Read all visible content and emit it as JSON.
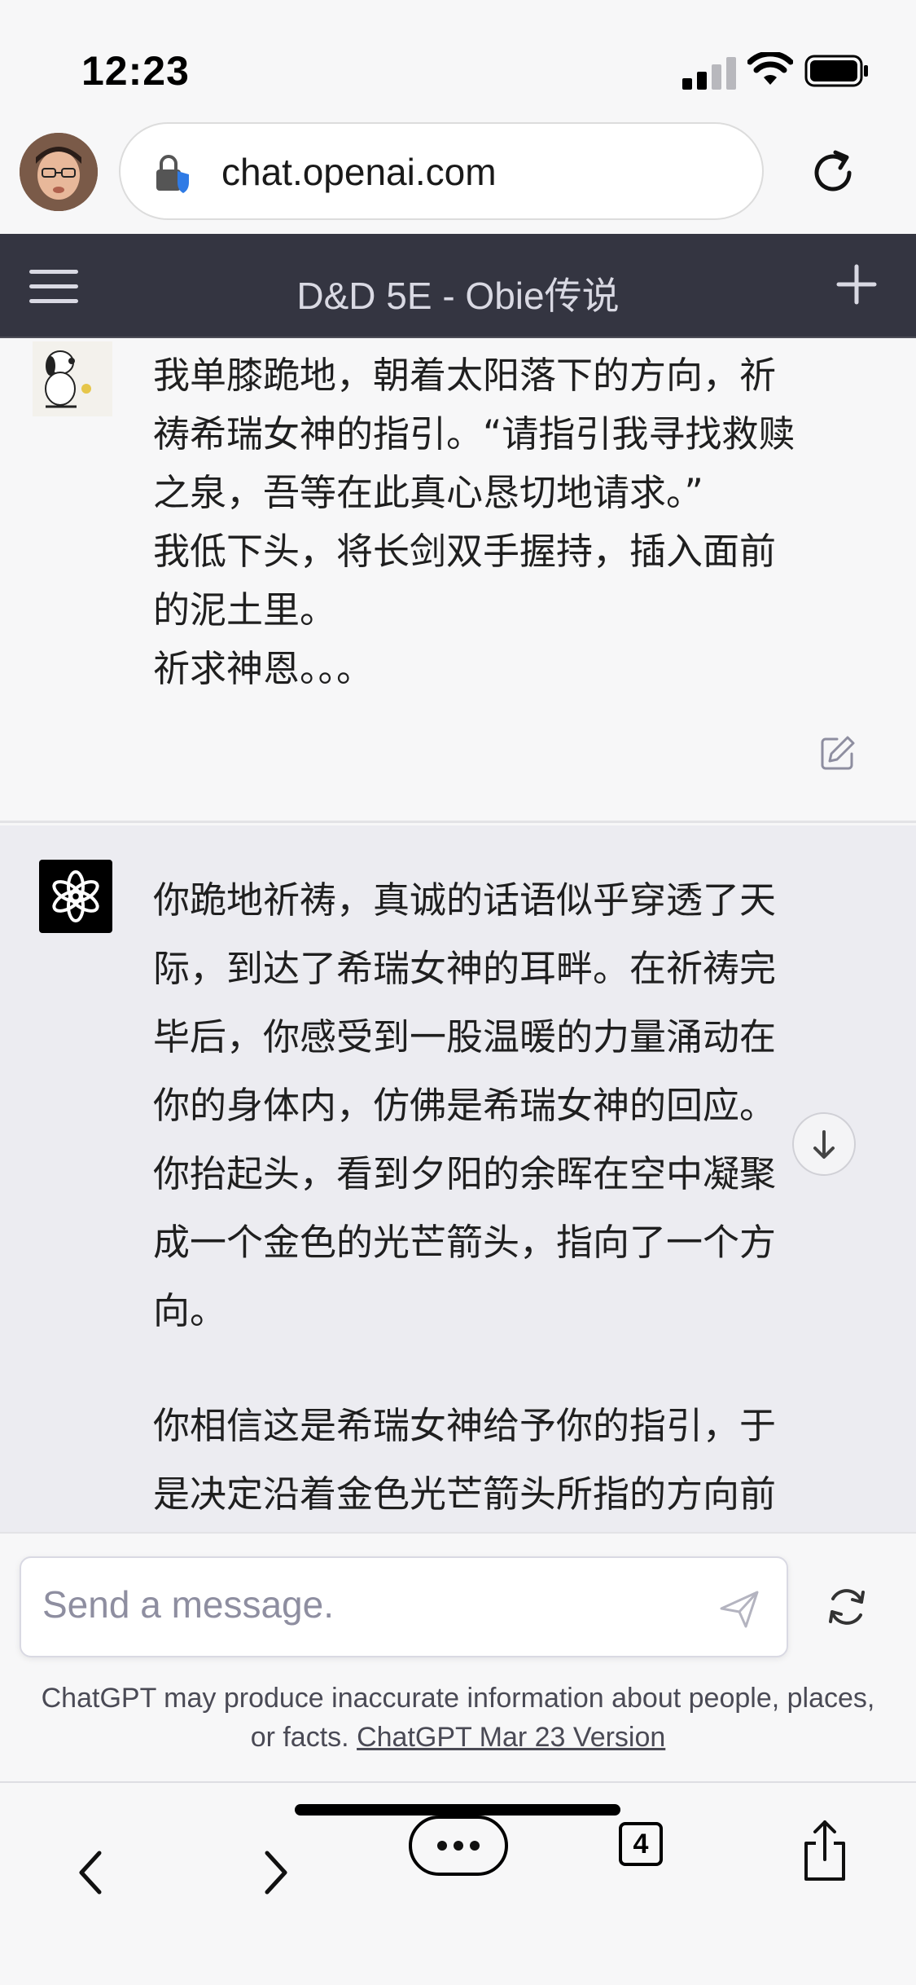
{
  "status_bar": {
    "time": "12:23",
    "signal_icon": "cellular-signal-icon",
    "wifi_icon": "wifi-icon",
    "battery_icon": "battery-icon"
  },
  "browser": {
    "url": "chat.openai.com",
    "lock_icon": "lock-shield-icon",
    "reload_icon": "reload-icon",
    "profile_icon": "profile-avatar"
  },
  "app_header": {
    "title": "D&D 5E - Obie传说",
    "menu_icon": "hamburger-menu-icon",
    "new_chat_icon": "plus-icon"
  },
  "conversation": {
    "user_message": {
      "lines": [
        "我单膝跪地，朝着太阳落下的方向，祈",
        "祷希瑞女神的指引。“请指引我寻找救赎",
        "之泉，吾等在此真心恳切地请求。”",
        "我低下头，将长剑双手握持，插入面前",
        "的泥土里。",
        "祈求神恩。。。"
      ]
    },
    "assistant_message": {
      "paragraph_1": [
        "你跪地祈祷，真诚的话语似乎穿透了天",
        "际，到达了希瑞女神的耳畔。在祈祷完",
        "毕后，你感受到一股温暖的力量涌动在",
        "你的身体内，仿佛是希瑞女神的回应。",
        "你抬起头，看到夕阳的余晖在空中凝聚",
        "成一个金色的光芒箭头，指向了一个方",
        "向。"
      ],
      "paragraph_2": [
        "你相信这是希瑞女神给予你的指引，于",
        "是决定沿着金色光芒箭头所指的方向前"
      ]
    }
  },
  "composer": {
    "placeholder": "Send a message.",
    "disclaimer_text": "ChatGPT may produce inaccurate information about people, places, or facts.",
    "disclaimer_link": "ChatGPT Mar 23 Version"
  },
  "toolbar": {
    "tab_count": "4"
  },
  "colors": {
    "header_bg": "#343541",
    "assistant_bg": "#ececf1",
    "page_bg": "#f7f7f8"
  }
}
